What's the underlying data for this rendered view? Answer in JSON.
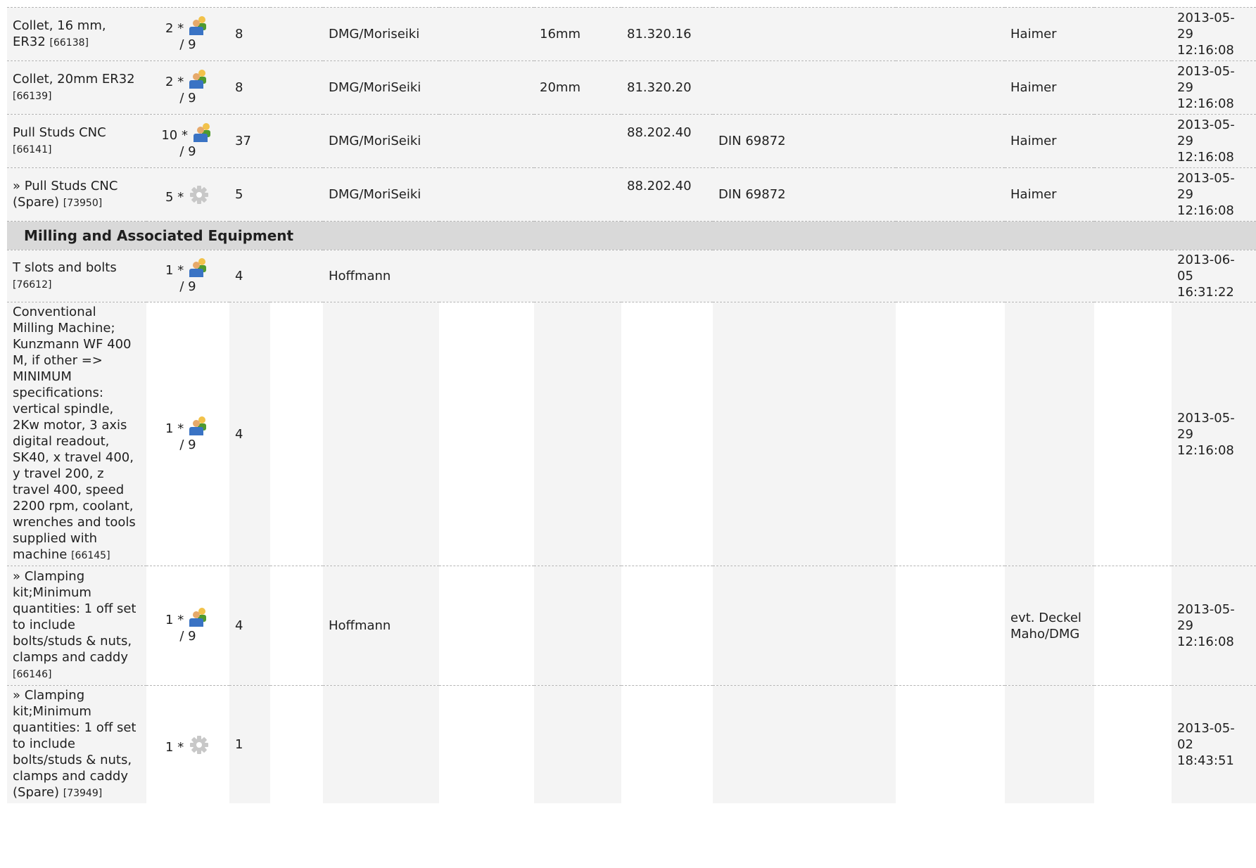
{
  "section": {
    "title": "Milling and Associated Equipment"
  },
  "qty_of": "/ 9",
  "rows_top": [
    {
      "name": "Collet, 16 mm, ER32",
      "id": "[66138]",
      "qty": "2 *",
      "icon": "person-group-icon",
      "of": "/ 9",
      "count": "8",
      "brand": "DMG/Moriseiki",
      "size": "16mm",
      "part": "81.320.16",
      "std": "",
      "supplier": "Haimer",
      "date": [
        "2013-05-",
        "29",
        "12:16:08"
      ]
    },
    {
      "name": "Collet, 20mm ER32",
      "id": "[66139]",
      "qty": "2 *",
      "icon": "person-group-icon",
      "of": "/ 9",
      "count": "8",
      "brand": "DMG/MoriSeiki",
      "size": "20mm",
      "part": "81.320.20",
      "std": "",
      "supplier": "Haimer",
      "date": [
        "2013-05-",
        "29",
        "12:16:08"
      ]
    },
    {
      "name": "Pull Studs CNC",
      "id": "[66141]",
      "qty": "10 *",
      "icon": "person-group-icon",
      "of": "/ 9",
      "count": "37",
      "brand": "DMG/MoriSeiki",
      "size": "",
      "part": "88.202.40",
      "std": "DIN 69872",
      "supplier": "Haimer",
      "date": [
        "2013-05-",
        "29",
        "12:16:08"
      ]
    },
    {
      "name": "» Pull Studs CNC (Spare)",
      "id": "[73950]",
      "qty": "5 *",
      "icon": "gear-icon",
      "of": "",
      "count": "5",
      "brand": "DMG/MoriSeiki",
      "size": "",
      "part": "88.202.40",
      "std": "DIN 69872",
      "supplier": "Haimer",
      "date": [
        "2013-05-",
        "29",
        "12:16:08"
      ]
    }
  ],
  "rows_bottom": [
    {
      "name": "T slots and bolts",
      "id": "[76612]",
      "qty": "1 *",
      "icon": "person-group-icon",
      "of": "/ 9",
      "count": "4",
      "brand": "Hoffmann",
      "size": "",
      "part": "",
      "std": "",
      "supplier": "",
      "date": [
        "2013-06-",
        "05",
        "16:31:22"
      ]
    },
    {
      "name": "Conventional Milling Machine; Kunzmann WF 400 M, if other => MINIMUM specifications: vertical spindle, 2Kw motor, 3 axis digital readout, SK40, x travel 400, y travel 200, z travel 400, speed 2200 rpm, coolant, wrenches and tools supplied with machine",
      "id": "[66145]",
      "qty": "1 *",
      "icon": "person-group-icon",
      "of": "/ 9",
      "count": "4",
      "brand": "",
      "size": "",
      "part": "",
      "std": "",
      "supplier": "",
      "date": [
        "2013-05-",
        "29",
        "12:16:08"
      ]
    },
    {
      "name": "» Clamping kit;Minimum quantities: 1 off set to include bolts/studs & nuts, clamps and caddy",
      "id": "[66146]",
      "qty": "1 *",
      "icon": "person-group-icon",
      "of": "/ 9",
      "count": "4",
      "brand": "Hoffmann",
      "size": "",
      "part": "",
      "std": "",
      "supplier": "evt. Deckel Maho/DMG",
      "date": [
        "2013-05-",
        "29",
        "12:16:08"
      ]
    },
    {
      "name": "» Clamping kit;Minimum quantities: 1 off set to include bolts/studs & nuts, clamps and caddy (Spare)",
      "id": "[73949]",
      "qty": "1 *",
      "icon": "gear-icon",
      "of": "",
      "count": "1",
      "brand": "",
      "size": "",
      "part": "",
      "std": "",
      "supplier": "",
      "date": [
        "2013-05-",
        "02",
        "18:43:51"
      ]
    }
  ]
}
